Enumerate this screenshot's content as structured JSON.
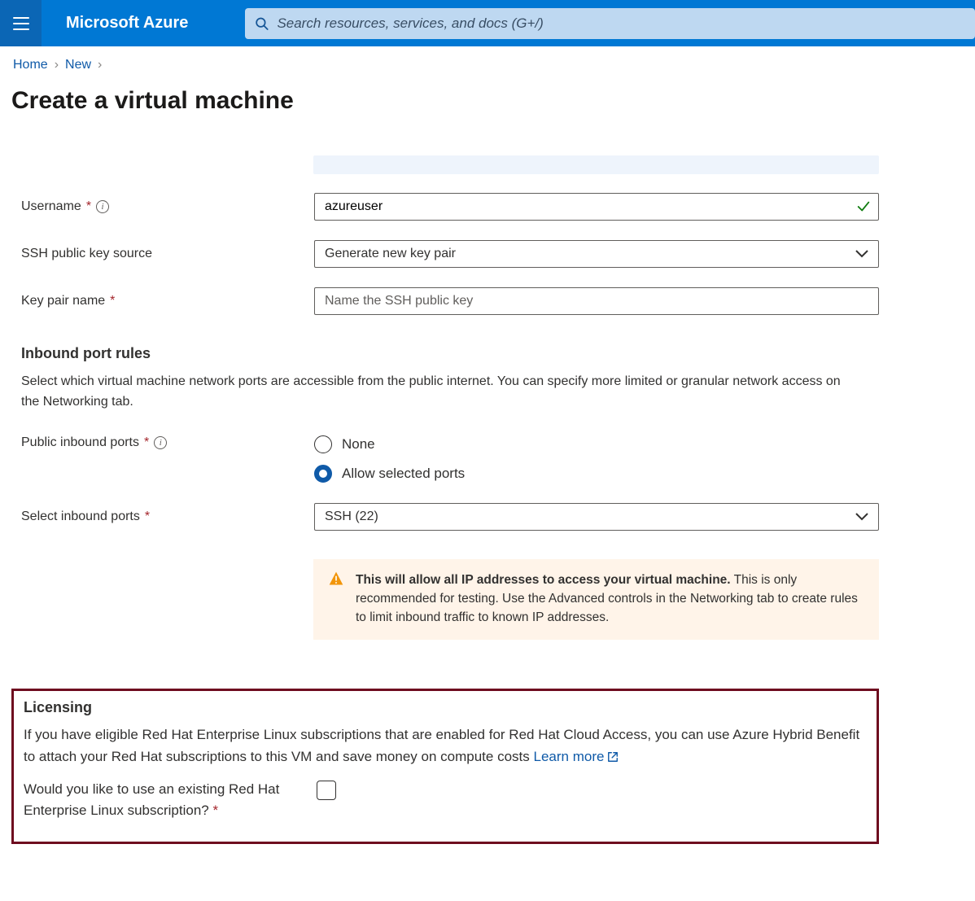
{
  "header": {
    "brand": "Microsoft Azure",
    "search_placeholder": "Search resources, services, and docs (G+/)"
  },
  "breadcrumb": {
    "home": "Home",
    "new": "New"
  },
  "page": {
    "title": "Create a virtual machine"
  },
  "form": {
    "username": {
      "label": "Username",
      "value": "azureuser"
    },
    "ssh_source": {
      "label": "SSH public key source",
      "value": "Generate new key pair"
    },
    "key_pair": {
      "label": "Key pair name",
      "placeholder": "Name the SSH public key"
    }
  },
  "inbound": {
    "heading": "Inbound port rules",
    "desc": "Select which virtual machine network ports are accessible from the public internet. You can specify more limited or granular network access on the Networking tab.",
    "public_label": "Public inbound ports",
    "opt_none": "None",
    "opt_allow": "Allow selected ports",
    "select_label": "Select inbound ports",
    "select_value": "SSH (22)",
    "warn_bold": "This will allow all IP addresses to access your virtual machine.",
    "warn_rest": "This is only recommended for testing.  Use the Advanced controls in the Networking tab to create rules to limit inbound traffic to known IP addresses."
  },
  "licensing": {
    "heading": "Licensing",
    "desc": "If you have eligible Red Hat Enterprise Linux subscriptions that are enabled for Red Hat Cloud Access, you can use Azure Hybrid Benefit to attach your Red Hat subscriptions to this VM and save money on compute costs",
    "learn": "Learn more",
    "q": "Would you like to use an existing Red Hat Enterprise Linux subscription?"
  }
}
